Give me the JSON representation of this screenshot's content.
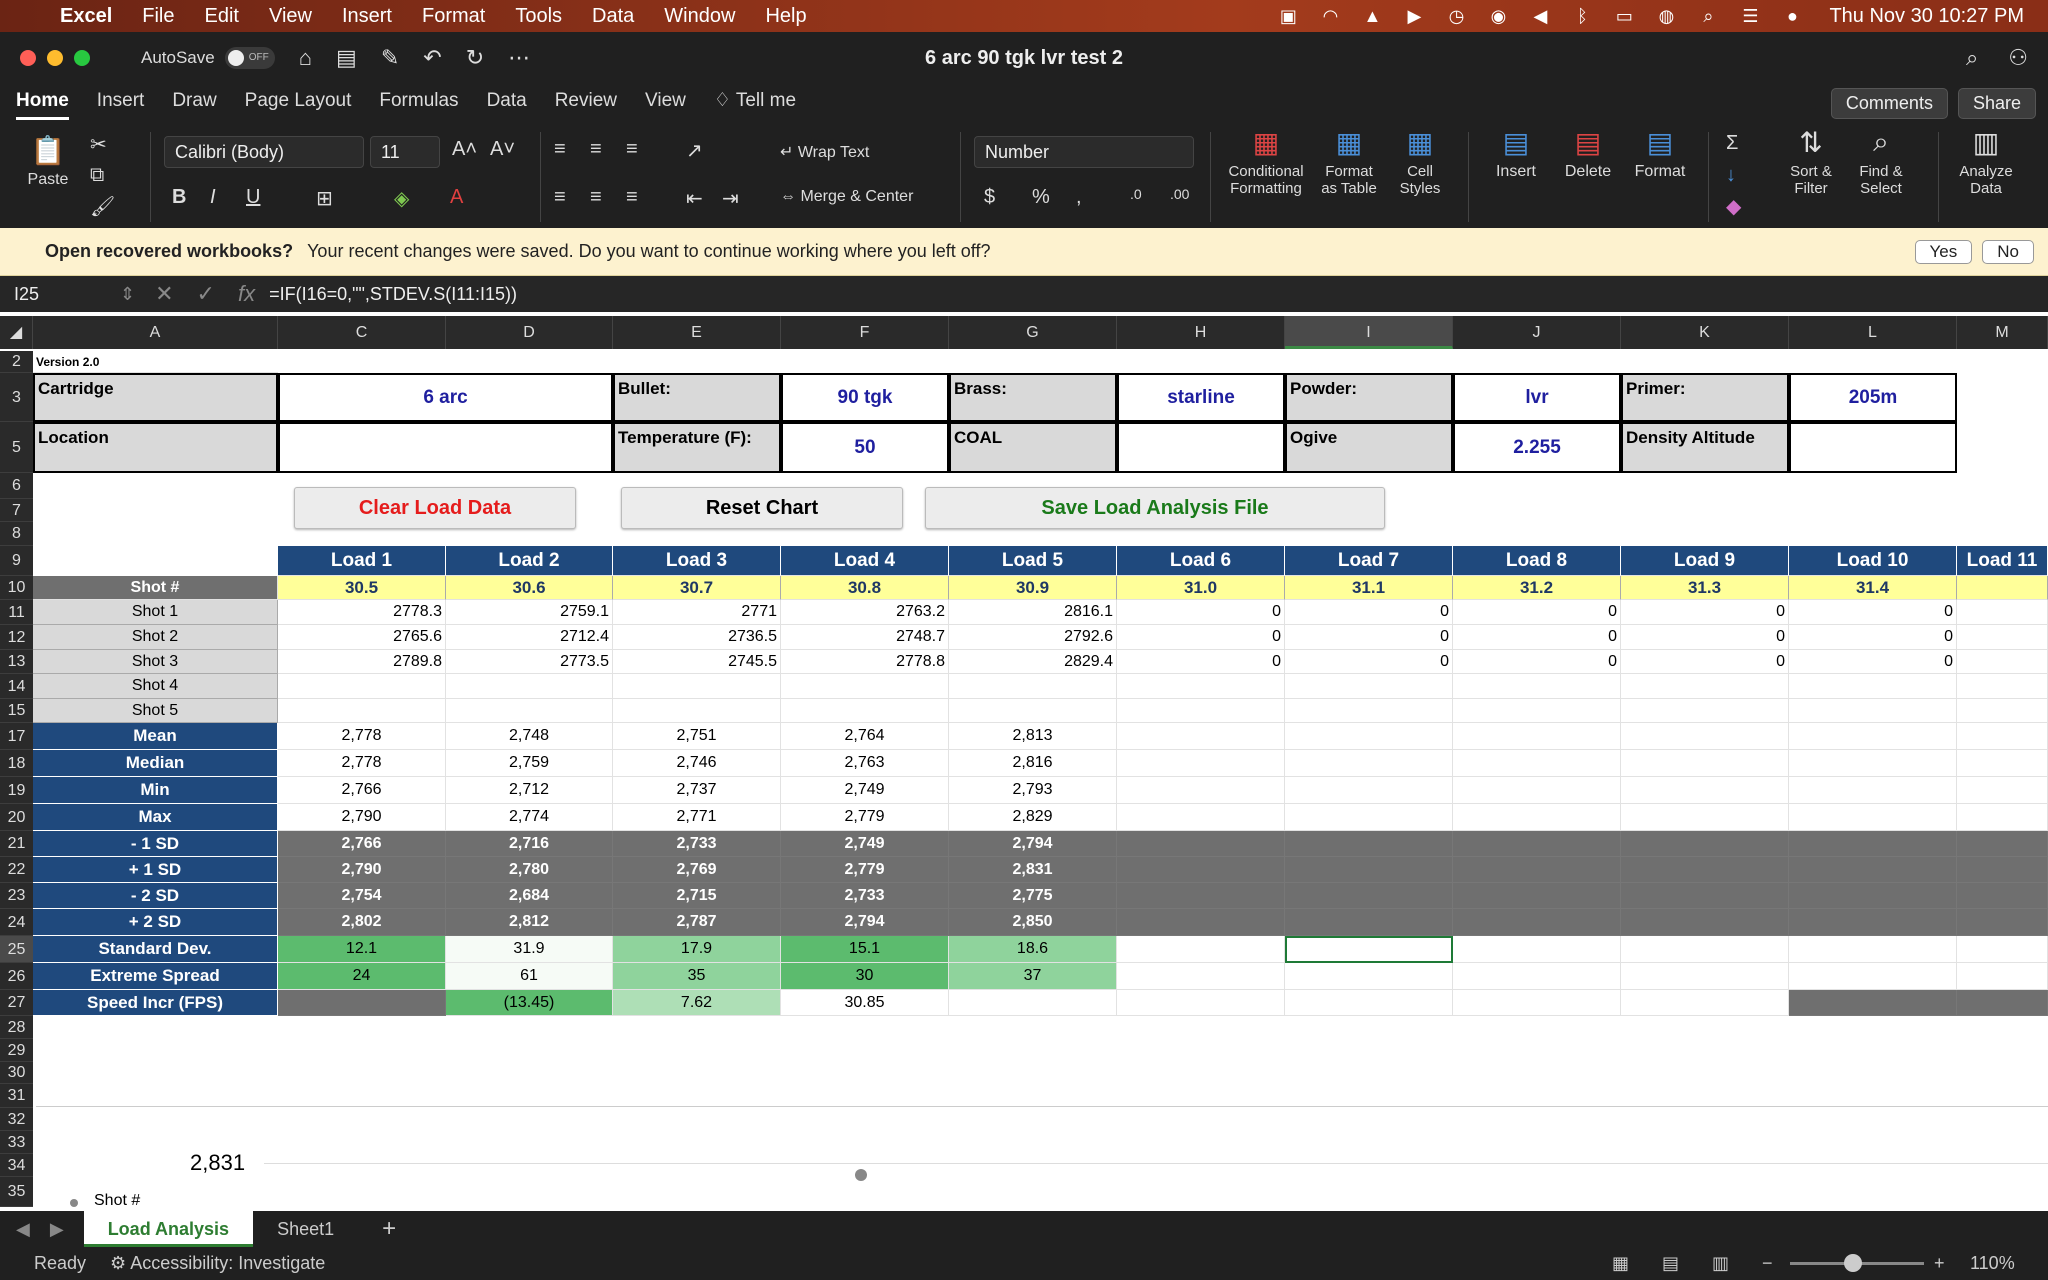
{
  "menubar": {
    "app": "Excel",
    "items": [
      "File",
      "Edit",
      "View",
      "Insert",
      "Format",
      "Tools",
      "Data",
      "Window",
      "Help"
    ],
    "clock": "Thu Nov 30  10:27 PM"
  },
  "titlebar": {
    "autosave": "AutoSave",
    "toggle": "OFF",
    "title": "6 arc 90 tgk lvr test 2"
  },
  "tabs": [
    "Home",
    "Insert",
    "Draw",
    "Page Layout",
    "Formulas",
    "Data",
    "Review",
    "View"
  ],
  "tellme": "Tell me",
  "comments": "Comments",
  "share": "Share",
  "ribbon": {
    "paste": "Paste",
    "font": "Calibri (Body)",
    "size": "11",
    "wrap": "Wrap Text",
    "merge": "Merge & Center",
    "numfmt": "Number",
    "cond1": "Conditional",
    "cond2": "Formatting",
    "fat1": "Format",
    "fat2": "as Table",
    "cs1": "Cell",
    "cs2": "Styles",
    "insert": "Insert",
    "delete": "Delete",
    "format": "Format",
    "sort1": "Sort &",
    "sort2": "Filter",
    "find1": "Find &",
    "find2": "Select",
    "an1": "Analyze",
    "an2": "Data"
  },
  "notice": {
    "bold": "Open recovered workbooks?",
    "text": "Your recent changes were saved. Do you want to continue working where you left off?",
    "yes": "Yes",
    "no": "No"
  },
  "formula": {
    "ref": "I25",
    "text": "=IF(I16=0,\"\",STDEV.S(I11:I15))"
  },
  "columns": [
    "A",
    "C",
    "D",
    "E",
    "F",
    "G",
    "H",
    "I",
    "J",
    "K",
    "L",
    "M"
  ],
  "rows": [
    "2",
    "3",
    "5",
    "6",
    "7",
    "8",
    "9",
    "10",
    "11",
    "12",
    "13",
    "14",
    "15",
    "17",
    "18",
    "19",
    "20",
    "21",
    "22",
    "23",
    "24",
    "25",
    "26",
    "27",
    "28",
    "29",
    "30",
    "31",
    "32",
    "33",
    "34",
    "35"
  ],
  "version": "Version 2.0",
  "info": {
    "cartridge_l": "Cartridge",
    "cartridge": "6 arc",
    "bullet_l": "Bullet:",
    "bullet": "90 tgk",
    "brass_l": "Brass:",
    "brass": "starline",
    "powder_l": "Powder:",
    "powder": "lvr",
    "primer_l": "Primer:",
    "primer": "205m",
    "location_l": "Location",
    "temp_l": "Temperature (F):",
    "temp": "50",
    "coal_l": "COAL",
    "ogive_l": "Ogive",
    "ogive": "2.255",
    "da_l": "Density Altitude"
  },
  "buttons": {
    "clear": "Clear Load Data",
    "reset": "Reset Chart",
    "save": "Save Load Analysis File"
  },
  "loads": [
    "Load 1",
    "Load 2",
    "Load 3",
    "Load 4",
    "Load 5",
    "Load 6",
    "Load 7",
    "Load 8",
    "Load 9",
    "Load 10",
    "Load 11"
  ],
  "charges": [
    "30.5",
    "30.6",
    "30.7",
    "30.8",
    "30.9",
    "31.0",
    "31.1",
    "31.2",
    "31.3",
    "31.4"
  ],
  "shot_hdr": "Shot #",
  "shots": [
    {
      "label": "Shot 1",
      "vals": [
        "2778.3",
        "2759.1",
        "2771",
        "2763.2",
        "2816.1",
        "0",
        "0",
        "0",
        "0",
        "0"
      ]
    },
    {
      "label": "Shot 2",
      "vals": [
        "2765.6",
        "2712.4",
        "2736.5",
        "2748.7",
        "2792.6",
        "0",
        "0",
        "0",
        "0",
        "0"
      ]
    },
    {
      "label": "Shot 3",
      "vals": [
        "2789.8",
        "2773.5",
        "2745.5",
        "2778.8",
        "2829.4",
        "0",
        "0",
        "0",
        "0",
        "0"
      ]
    },
    {
      "label": "Shot 4",
      "vals": []
    },
    {
      "label": "Shot 5",
      "vals": []
    }
  ],
  "stats": [
    {
      "label": "Mean",
      "vals": [
        "2,778",
        "2,748",
        "2,751",
        "2,764",
        "2,813"
      ]
    },
    {
      "label": "Median",
      "vals": [
        "2,778",
        "2,759",
        "2,746",
        "2,763",
        "2,816"
      ]
    },
    {
      "label": "Min",
      "vals": [
        "2,766",
        "2,712",
        "2,737",
        "2,749",
        "2,793"
      ]
    },
    {
      "label": "Max",
      "vals": [
        "2,790",
        "2,774",
        "2,771",
        "2,779",
        "2,829"
      ]
    }
  ],
  "sd": [
    {
      "label": "- 1 SD",
      "vals": [
        "2,766",
        "2,716",
        "2,733",
        "2,749",
        "2,794"
      ]
    },
    {
      "label": "+ 1 SD",
      "vals": [
        "2,790",
        "2,780",
        "2,769",
        "2,779",
        "2,831"
      ]
    },
    {
      "label": "- 2 SD",
      "vals": [
        "2,754",
        "2,684",
        "2,715",
        "2,733",
        "2,775"
      ]
    },
    {
      "label": "+ 2 SD",
      "vals": [
        "2,802",
        "2,812",
        "2,787",
        "2,794",
        "2,850"
      ]
    }
  ],
  "stdev": {
    "label": "Standard Dev.",
    "vals": [
      "12.1",
      "31.9",
      "17.9",
      "15.1",
      "18.6"
    ]
  },
  "es": {
    "label": "Extreme Spread",
    "vals": [
      "24",
      "61",
      "35",
      "30",
      "37"
    ]
  },
  "speed": {
    "label": "Speed Incr (FPS)",
    "vals": [
      "",
      "(13.45)",
      "7.62",
      "30.85"
    ]
  },
  "chart": {
    "ytick": "2,831",
    "legend": "Shot #"
  },
  "sheets": [
    "Load Analysis",
    "Sheet1"
  ],
  "status": {
    "ready": "Ready",
    "access": "Accessibility: Investigate",
    "zoom": "110%"
  }
}
